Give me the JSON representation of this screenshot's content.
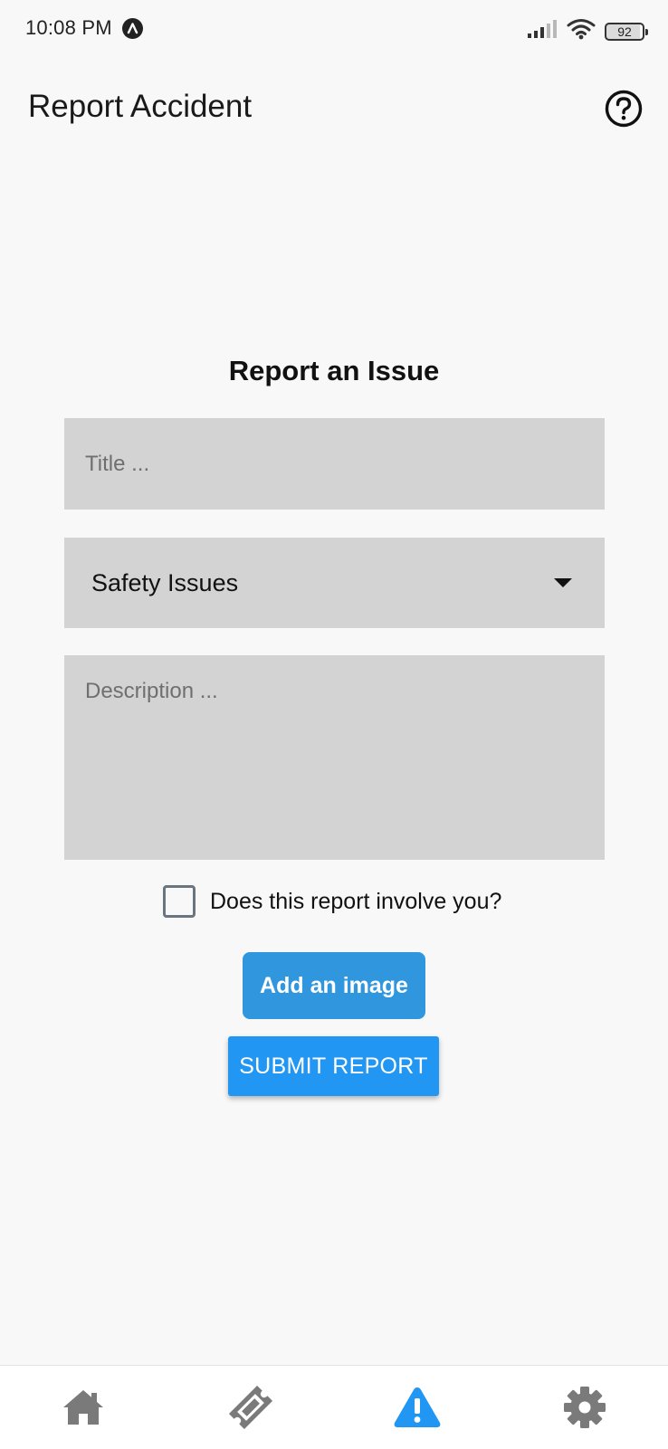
{
  "status_bar": {
    "time": "10:08 PM",
    "battery": "92",
    "battery_level": 0.92,
    "icons": [
      "app-notification-icon",
      "signal-icon",
      "wifi-icon",
      "battery-icon"
    ]
  },
  "header": {
    "title": "Report Accident",
    "help_icon": "help-circle-icon"
  },
  "form": {
    "heading": "Report an Issue",
    "title_placeholder": "Title ...",
    "title_value": "",
    "category_value": "Safety Issues",
    "description_placeholder": "Description ...",
    "description_value": "",
    "involve_label": "Does this report involve you?",
    "involve_checked": false,
    "add_image_label": "Add an image",
    "submit_label": "SUBMIT REPORT"
  },
  "bottom_nav": {
    "tabs": [
      {
        "icon": "home-icon",
        "active": false
      },
      {
        "icon": "ticket-icon",
        "active": false
      },
      {
        "icon": "warning-icon",
        "active": true
      },
      {
        "icon": "settings-icon",
        "active": false
      }
    ]
  },
  "colors": {
    "background": "#f8f8f8",
    "field": "#d3d3d3",
    "add_image_button": "#3096de",
    "submit_button": "#2196f3",
    "nav_active": "#2196f3",
    "nav_inactive": "#7a7a7a"
  }
}
